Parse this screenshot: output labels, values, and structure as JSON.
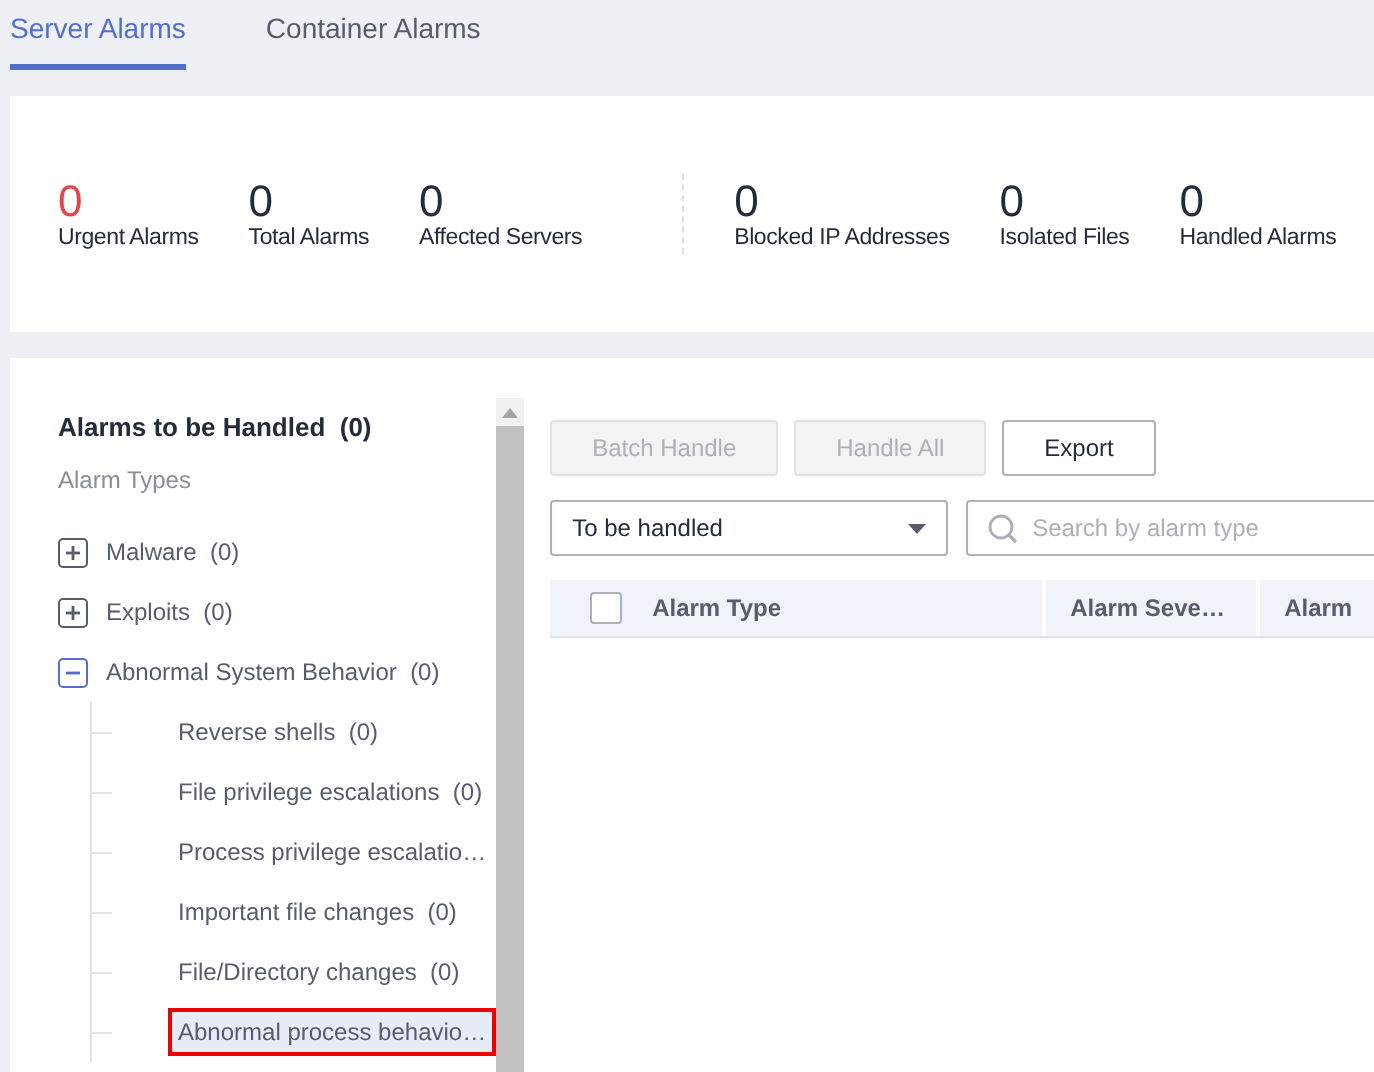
{
  "tabs": [
    {
      "label": "Server Alarms",
      "selected": true
    },
    {
      "label": "Container Alarms",
      "selected": false
    }
  ],
  "stats": {
    "groups": [
      [
        {
          "value": "0",
          "label": "Urgent Alarms",
          "urgent": true
        },
        {
          "value": "0",
          "label": "Total Alarms",
          "urgent": false
        },
        {
          "value": "0",
          "label": "Affected Servers",
          "urgent": false
        }
      ],
      [
        {
          "value": "0",
          "label": "Blocked IP Addresses",
          "urgent": false
        },
        {
          "value": "0",
          "label": "Isolated Files",
          "urgent": false
        },
        {
          "value": "0",
          "label": "Handled Alarms",
          "urgent": false
        }
      ]
    ]
  },
  "sidebar": {
    "title": "Alarms to be Handled",
    "count": "(0)",
    "subtitle": "Alarm Types",
    "tree": [
      {
        "label": "Malware",
        "count": "(0)",
        "expanded": false
      },
      {
        "label": "Exploits",
        "count": "(0)",
        "expanded": false
      },
      {
        "label": "Abnormal System Behavior",
        "count": "(0)",
        "expanded": true,
        "children": [
          {
            "label": "Reverse shells",
            "count": "(0)",
            "selected": false
          },
          {
            "label": "File privilege escalations",
            "count": "(0)",
            "selected": false
          },
          {
            "label": "Process privilege escalatio…",
            "selected": false
          },
          {
            "label": "Important file changes",
            "count": "(0)",
            "selected": false
          },
          {
            "label": "File/Directory changes",
            "count": "(0)",
            "selected": false
          },
          {
            "label": "Abnormal process behavio…",
            "selected": true
          }
        ]
      }
    ]
  },
  "toolbar": {
    "buttons": [
      {
        "label": "Batch Handle",
        "disabled": true
      },
      {
        "label": "Handle All",
        "disabled": true
      },
      {
        "label": "Export",
        "disabled": false
      }
    ]
  },
  "filter": {
    "value": "To be handled"
  },
  "search": {
    "placeholder": "Search by alarm type"
  },
  "table": {
    "select_all": {
      "checked": false
    },
    "columns": [
      "Alarm Type",
      "Alarm Seve…",
      "Alarm"
    ]
  }
}
